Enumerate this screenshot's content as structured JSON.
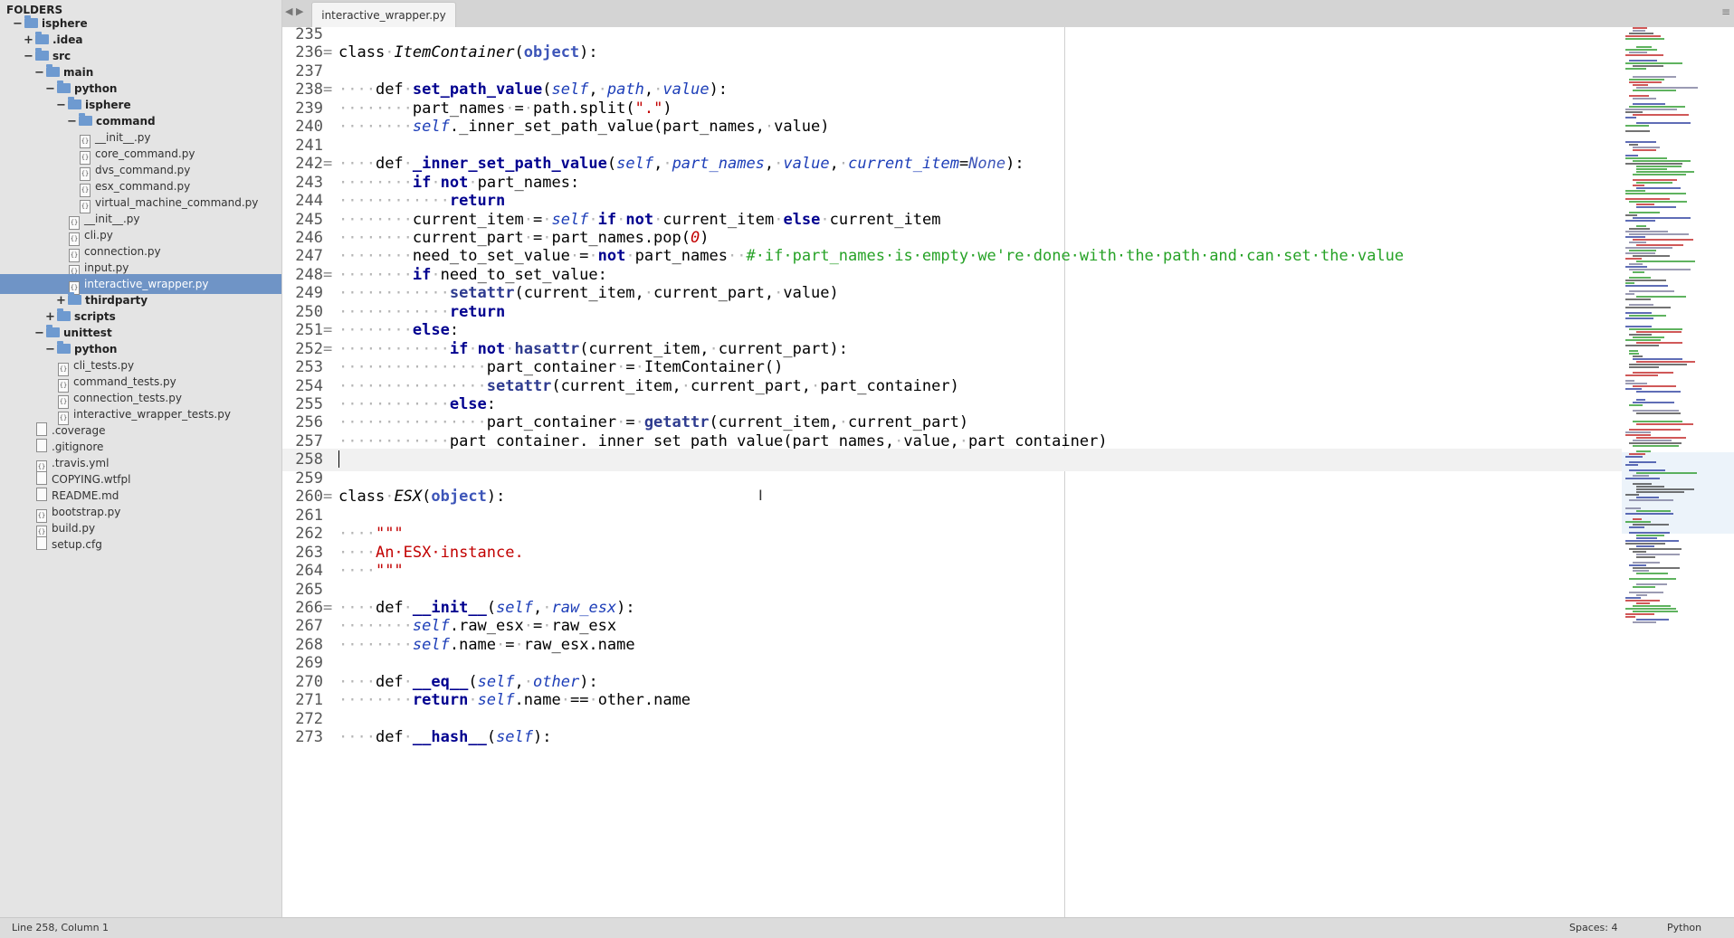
{
  "sidebar": {
    "header": "FOLDERS",
    "items": [
      {
        "label": "isphere",
        "type": "folder",
        "depth": 0,
        "toggle": "−"
      },
      {
        "label": ".idea",
        "type": "folder",
        "depth": 1,
        "toggle": "+"
      },
      {
        "label": "src",
        "type": "folder",
        "depth": 1,
        "toggle": "−"
      },
      {
        "label": "main",
        "type": "folder",
        "depth": 2,
        "toggle": "−"
      },
      {
        "label": "python",
        "type": "folder",
        "depth": 3,
        "toggle": "−"
      },
      {
        "label": "isphere",
        "type": "folder",
        "depth": 4,
        "toggle": "−"
      },
      {
        "label": "command",
        "type": "folder",
        "depth": 5,
        "toggle": "−"
      },
      {
        "label": "__init__.py",
        "type": "file",
        "depth": 6
      },
      {
        "label": "core_command.py",
        "type": "file",
        "depth": 6
      },
      {
        "label": "dvs_command.py",
        "type": "file",
        "depth": 6
      },
      {
        "label": "esx_command.py",
        "type": "file",
        "depth": 6
      },
      {
        "label": "virtual_machine_command.py",
        "type": "file",
        "depth": 6
      },
      {
        "label": "__init__.py",
        "type": "file",
        "depth": 5
      },
      {
        "label": "cli.py",
        "type": "file",
        "depth": 5
      },
      {
        "label": "connection.py",
        "type": "file",
        "depth": 5
      },
      {
        "label": "input.py",
        "type": "file",
        "depth": 5
      },
      {
        "label": "interactive_wrapper.py",
        "type": "file",
        "depth": 5,
        "selected": true
      },
      {
        "label": "thirdparty",
        "type": "folder",
        "depth": 4,
        "toggle": "+"
      },
      {
        "label": "scripts",
        "type": "folder",
        "depth": 3,
        "toggle": "+"
      },
      {
        "label": "unittest",
        "type": "folder",
        "depth": 2,
        "toggle": "−"
      },
      {
        "label": "python",
        "type": "folder",
        "depth": 3,
        "toggle": "−"
      },
      {
        "label": "cli_tests.py",
        "type": "file",
        "depth": 4
      },
      {
        "label": "command_tests.py",
        "type": "file",
        "depth": 4
      },
      {
        "label": "connection_tests.py",
        "type": "file",
        "depth": 4
      },
      {
        "label": "interactive_wrapper_tests.py",
        "type": "file",
        "depth": 4
      },
      {
        "label": ".coverage",
        "type": "plain",
        "depth": 2
      },
      {
        "label": ".gitignore",
        "type": "plain",
        "depth": 2
      },
      {
        "label": ".travis.yml",
        "type": "file",
        "depth": 2
      },
      {
        "label": "COPYING.wtfpl",
        "type": "plain",
        "depth": 2
      },
      {
        "label": "README.md",
        "type": "plain",
        "depth": 2
      },
      {
        "label": "bootstrap.py",
        "type": "file",
        "depth": 2
      },
      {
        "label": "build.py",
        "type": "file",
        "depth": 2
      },
      {
        "label": "setup.cfg",
        "type": "plain",
        "depth": 2
      }
    ]
  },
  "tabs": {
    "arrows": "◀ ▶",
    "active": "interactive_wrapper.py",
    "menu": "≡"
  },
  "editor": {
    "lines": [
      {
        "n": "235",
        "t": []
      },
      {
        "n": "236",
        "f": true,
        "t": [
          [
            "kw2",
            "class"
          ],
          [
            "w",
            "·"
          ],
          [
            "cls",
            "ItemContainer"
          ],
          [
            "op",
            "("
          ],
          [
            "obj",
            "object"
          ],
          [
            "op",
            "):"
          ]
        ]
      },
      {
        "n": "237",
        "t": []
      },
      {
        "n": "238",
        "f": true,
        "t": [
          [
            "w",
            "····"
          ],
          [
            "kw2",
            "def"
          ],
          [
            "w",
            "·"
          ],
          [
            "fn",
            "set_path_value"
          ],
          [
            "op",
            "("
          ],
          [
            "self",
            "self"
          ],
          [
            "op",
            ","
          ],
          [
            "w",
            "·"
          ],
          [
            "param",
            "path"
          ],
          [
            "op",
            ","
          ],
          [
            "w",
            "·"
          ],
          [
            "param",
            "value"
          ],
          [
            "op",
            "):"
          ]
        ]
      },
      {
        "n": "239",
        "t": [
          [
            "w",
            "········"
          ],
          [
            "op",
            "part_names"
          ],
          [
            "w",
            "·"
          ],
          [
            "op",
            "="
          ],
          [
            "w",
            "·"
          ],
          [
            "op",
            "path.split("
          ],
          [
            "str",
            "\".\""
          ],
          [
            "op",
            ")"
          ]
        ]
      },
      {
        "n": "240",
        "t": [
          [
            "w",
            "········"
          ],
          [
            "self",
            "self"
          ],
          [
            "op",
            "._inner_set_path_value(part_names,"
          ],
          [
            "w",
            "·"
          ],
          [
            "op",
            "value)"
          ]
        ]
      },
      {
        "n": "241",
        "t": []
      },
      {
        "n": "242",
        "f": true,
        "t": [
          [
            "w",
            "····"
          ],
          [
            "kw2",
            "def"
          ],
          [
            "w",
            "·"
          ],
          [
            "fn",
            "_inner_set_path_value"
          ],
          [
            "op",
            "("
          ],
          [
            "self",
            "self"
          ],
          [
            "op",
            ","
          ],
          [
            "w",
            "·"
          ],
          [
            "param",
            "part_names"
          ],
          [
            "op",
            ","
          ],
          [
            "w",
            "·"
          ],
          [
            "param",
            "value"
          ],
          [
            "op",
            ","
          ],
          [
            "w",
            "·"
          ],
          [
            "param",
            "current_item"
          ],
          [
            "op",
            "="
          ],
          [
            "none",
            "None"
          ],
          [
            "op",
            "):"
          ]
        ]
      },
      {
        "n": "243",
        "t": [
          [
            "w",
            "········"
          ],
          [
            "kw",
            "if"
          ],
          [
            "w",
            "·"
          ],
          [
            "kw",
            "not"
          ],
          [
            "w",
            "·"
          ],
          [
            "op",
            "part_names:"
          ]
        ]
      },
      {
        "n": "244",
        "t": [
          [
            "w",
            "············"
          ],
          [
            "kw",
            "return"
          ]
        ]
      },
      {
        "n": "245",
        "t": [
          [
            "w",
            "········"
          ],
          [
            "op",
            "current_item"
          ],
          [
            "w",
            "·"
          ],
          [
            "op",
            "="
          ],
          [
            "w",
            "·"
          ],
          [
            "self",
            "self"
          ],
          [
            "w",
            "·"
          ],
          [
            "kw",
            "if"
          ],
          [
            "w",
            "·"
          ],
          [
            "kw",
            "not"
          ],
          [
            "w",
            "·"
          ],
          [
            "op",
            "current_item"
          ],
          [
            "w",
            "·"
          ],
          [
            "kw",
            "else"
          ],
          [
            "w",
            "·"
          ],
          [
            "op",
            "current_item"
          ]
        ]
      },
      {
        "n": "246",
        "t": [
          [
            "w",
            "········"
          ],
          [
            "op",
            "current_part"
          ],
          [
            "w",
            "·"
          ],
          [
            "op",
            "="
          ],
          [
            "w",
            "·"
          ],
          [
            "op",
            "part_names.pop("
          ],
          [
            "num",
            "0"
          ],
          [
            "op",
            ")"
          ]
        ]
      },
      {
        "n": "247",
        "t": [
          [
            "w",
            "········"
          ],
          [
            "op",
            "need_to_set_value"
          ],
          [
            "w",
            "·"
          ],
          [
            "op",
            "="
          ],
          [
            "w",
            "·"
          ],
          [
            "kw",
            "not"
          ],
          [
            "w",
            "·"
          ],
          [
            "op",
            "part_names"
          ],
          [
            "w",
            "··"
          ],
          [
            "cmt",
            "#·if·part_names·is·empty·we're·done·with·the·path·and·can·set·the·value"
          ]
        ]
      },
      {
        "n": "248",
        "f": true,
        "t": [
          [
            "w",
            "········"
          ],
          [
            "kw",
            "if"
          ],
          [
            "w",
            "·"
          ],
          [
            "op",
            "need_to_set_value:"
          ]
        ]
      },
      {
        "n": "249",
        "t": [
          [
            "w",
            "············"
          ],
          [
            "bi",
            "setattr"
          ],
          [
            "op",
            "(current_item,"
          ],
          [
            "w",
            "·"
          ],
          [
            "op",
            "current_part,"
          ],
          [
            "w",
            "·"
          ],
          [
            "op",
            "value)"
          ]
        ]
      },
      {
        "n": "250",
        "t": [
          [
            "w",
            "············"
          ],
          [
            "kw",
            "return"
          ]
        ]
      },
      {
        "n": "251",
        "f": true,
        "t": [
          [
            "w",
            "········"
          ],
          [
            "kw",
            "else"
          ],
          [
            "op",
            ":"
          ]
        ]
      },
      {
        "n": "252",
        "f": true,
        "t": [
          [
            "w",
            "············"
          ],
          [
            "kw",
            "if"
          ],
          [
            "w",
            "·"
          ],
          [
            "kw",
            "not"
          ],
          [
            "w",
            "·"
          ],
          [
            "bi",
            "hasattr"
          ],
          [
            "op",
            "(current_item,"
          ],
          [
            "w",
            "·"
          ],
          [
            "op",
            "current_part):"
          ]
        ]
      },
      {
        "n": "253",
        "t": [
          [
            "w",
            "················"
          ],
          [
            "op",
            "part_container"
          ],
          [
            "w",
            "·"
          ],
          [
            "op",
            "="
          ],
          [
            "w",
            "·"
          ],
          [
            "op",
            "ItemContainer()"
          ]
        ]
      },
      {
        "n": "254",
        "t": [
          [
            "w",
            "················"
          ],
          [
            "bi",
            "setattr"
          ],
          [
            "op",
            "(current_item,"
          ],
          [
            "w",
            "·"
          ],
          [
            "op",
            "current_part,"
          ],
          [
            "w",
            "·"
          ],
          [
            "op",
            "part_container)"
          ]
        ]
      },
      {
        "n": "255",
        "t": [
          [
            "w",
            "············"
          ],
          [
            "kw",
            "else"
          ],
          [
            "op",
            ":"
          ]
        ]
      },
      {
        "n": "256",
        "t": [
          [
            "w",
            "················"
          ],
          [
            "op",
            "part_container"
          ],
          [
            "w",
            "·"
          ],
          [
            "op",
            "="
          ],
          [
            "w",
            "·"
          ],
          [
            "bi",
            "getattr"
          ],
          [
            "op",
            "(current_item,"
          ],
          [
            "w",
            "·"
          ],
          [
            "op",
            "current_part)"
          ]
        ]
      },
      {
        "n": "257",
        "t": [
          [
            "w",
            "············"
          ],
          [
            "op",
            "part_container._inner_set_path_value(part_names,"
          ],
          [
            "w",
            "·"
          ],
          [
            "op",
            "value,"
          ],
          [
            "w",
            "·"
          ],
          [
            "op",
            "part_container)"
          ]
        ]
      },
      {
        "n": "258",
        "current": true,
        "t": []
      },
      {
        "n": "259",
        "t": []
      },
      {
        "n": "260",
        "f": true,
        "t": [
          [
            "kw2",
            "class"
          ],
          [
            "w",
            "·"
          ],
          [
            "cls",
            "ESX"
          ],
          [
            "op",
            "("
          ],
          [
            "obj",
            "object"
          ],
          [
            "op",
            "):"
          ]
        ]
      },
      {
        "n": "261",
        "t": []
      },
      {
        "n": "262",
        "t": [
          [
            "w",
            "····"
          ],
          [
            "str",
            "\"\"\""
          ]
        ]
      },
      {
        "n": "263",
        "t": [
          [
            "w",
            "····"
          ],
          [
            "str",
            "An·ESX·instance."
          ]
        ]
      },
      {
        "n": "264",
        "t": [
          [
            "w",
            "····"
          ],
          [
            "str",
            "\"\"\""
          ]
        ]
      },
      {
        "n": "265",
        "t": []
      },
      {
        "n": "266",
        "f": true,
        "t": [
          [
            "w",
            "····"
          ],
          [
            "kw2",
            "def"
          ],
          [
            "w",
            "·"
          ],
          [
            "fn",
            "__init__"
          ],
          [
            "op",
            "("
          ],
          [
            "self",
            "self"
          ],
          [
            "op",
            ","
          ],
          [
            "w",
            "·"
          ],
          [
            "param",
            "raw_esx"
          ],
          [
            "op",
            "):"
          ]
        ]
      },
      {
        "n": "267",
        "t": [
          [
            "w",
            "········"
          ],
          [
            "self",
            "self"
          ],
          [
            "op",
            ".raw_esx"
          ],
          [
            "w",
            "·"
          ],
          [
            "op",
            "="
          ],
          [
            "w",
            "·"
          ],
          [
            "op",
            "raw_esx"
          ]
        ]
      },
      {
        "n": "268",
        "t": [
          [
            "w",
            "········"
          ],
          [
            "self",
            "self"
          ],
          [
            "op",
            ".name"
          ],
          [
            "w",
            "·"
          ],
          [
            "op",
            "="
          ],
          [
            "w",
            "·"
          ],
          [
            "op",
            "raw_esx.name"
          ]
        ]
      },
      {
        "n": "269",
        "t": []
      },
      {
        "n": "270",
        "t": [
          [
            "w",
            "····"
          ],
          [
            "kw2",
            "def"
          ],
          [
            "w",
            "·"
          ],
          [
            "fn",
            "__eq__"
          ],
          [
            "op",
            "("
          ],
          [
            "self",
            "self"
          ],
          [
            "op",
            ","
          ],
          [
            "w",
            "·"
          ],
          [
            "param",
            "other"
          ],
          [
            "op",
            "):"
          ]
        ]
      },
      {
        "n": "271",
        "t": [
          [
            "w",
            "········"
          ],
          [
            "kw",
            "return"
          ],
          [
            "w",
            "·"
          ],
          [
            "self",
            "self"
          ],
          [
            "op",
            ".name"
          ],
          [
            "w",
            "·"
          ],
          [
            "op",
            "=="
          ],
          [
            "w",
            "·"
          ],
          [
            "op",
            "other.name"
          ]
        ]
      },
      {
        "n": "272",
        "t": []
      },
      {
        "n": "273",
        "t": [
          [
            "w",
            "····"
          ],
          [
            "kw2",
            "def"
          ],
          [
            "w",
            "·"
          ],
          [
            "fn",
            "__hash__"
          ],
          [
            "op",
            "("
          ],
          [
            "self",
            "self"
          ],
          [
            "op",
            "):"
          ]
        ]
      }
    ]
  },
  "statusbar": {
    "position": "Line 258, Column 1",
    "spaces": "Spaces: 4",
    "syntax": "Python"
  },
  "colors": {
    "selection": "#6f94c6",
    "keyword": "#00008f",
    "string": "#c20000",
    "comment": "#26a226",
    "parameter": "#1d3eb8"
  }
}
